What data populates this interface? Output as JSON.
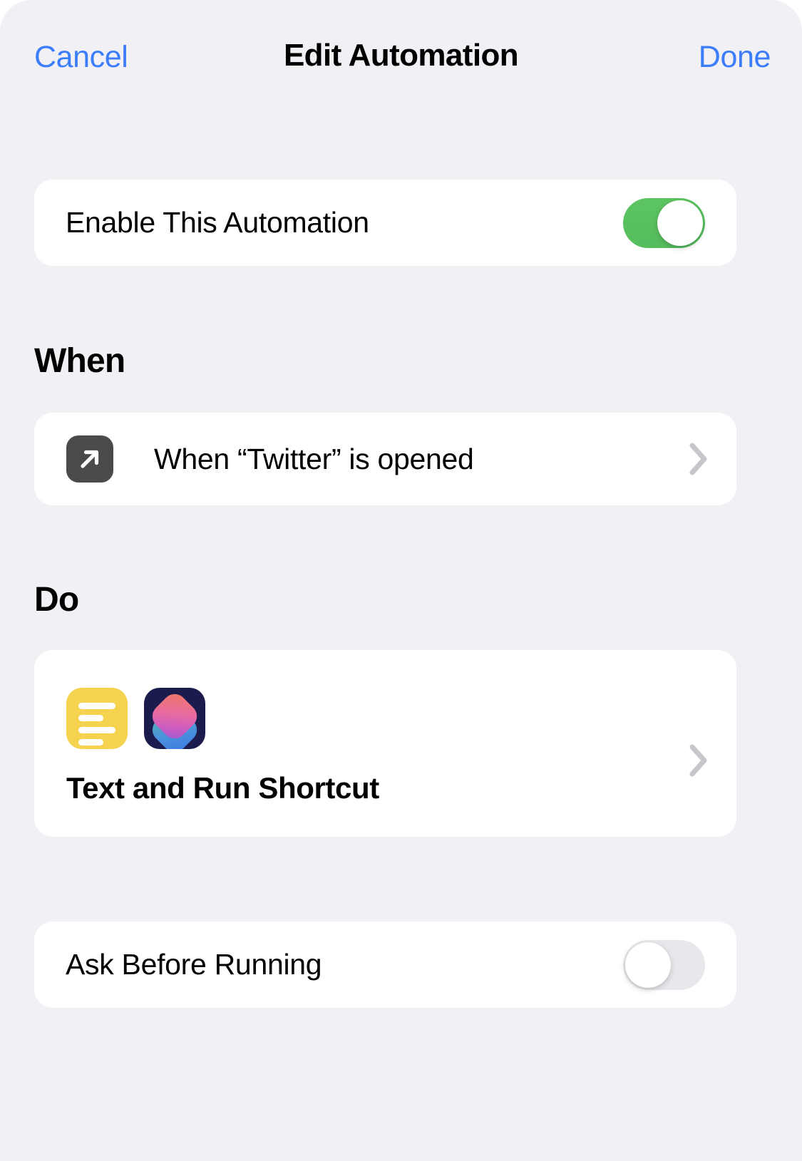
{
  "nav": {
    "cancel_label": "Cancel",
    "title": "Edit Automation",
    "done_label": "Done"
  },
  "enable_section": {
    "label": "Enable This Automation",
    "toggle_state": "on"
  },
  "when_section": {
    "heading": "When",
    "trigger_icon": "diagonal-arrow-icon",
    "trigger_label": "When “Twitter” is opened",
    "chevron": "chevron-right-icon"
  },
  "do_section": {
    "heading": "Do",
    "action_icons": [
      {
        "name": "text-action-icon"
      },
      {
        "name": "shortcuts-app-icon"
      }
    ],
    "action_label": "Text and Run Shortcut",
    "chevron": "chevron-right-icon"
  },
  "ask_section": {
    "label": "Ask Before Running",
    "toggle_state": "off"
  },
  "colors": {
    "background": "#f1f0f5",
    "card": "#ffffff",
    "accent_blue": "#3c7dfc",
    "toggle_on_green": "#55bd5e",
    "toggle_off_gray": "#e8e8ec",
    "chevron_gray": "#c6c6cb",
    "trigger_icon_gray": "#4a4a4c",
    "text_icon_yellow": "#f6d251",
    "shortcuts_icon_navy": "#1b1b4d"
  }
}
